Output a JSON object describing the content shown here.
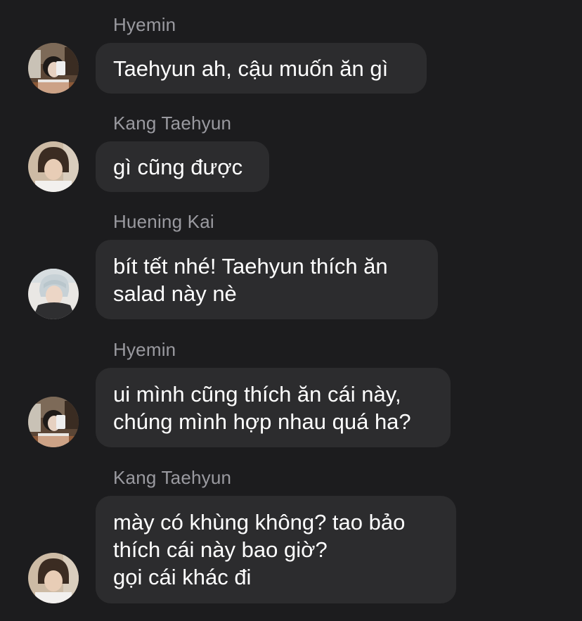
{
  "messages": [
    {
      "sender": "Hyemin",
      "avatar_icon": "profile-photo-hyemin",
      "lines": [
        "Taehyun ah, cậu muốn ăn gì"
      ]
    },
    {
      "sender": "Kang Taehyun",
      "avatar_icon": "profile-photo-taehyun",
      "lines": [
        "gì cũng được"
      ]
    },
    {
      "sender": "Huening Kai",
      "avatar_icon": "profile-photo-huening-kai",
      "lines": [
        "bít tết nhé! Taehyun thích ăn",
        "salad này nè"
      ]
    },
    {
      "sender": "Hyemin",
      "avatar_icon": "profile-photo-hyemin",
      "lines": [
        "ui mình cũng thích ăn cái này,",
        "chúng mình hợp nhau quá ha?"
      ]
    },
    {
      "sender": "Kang Taehyun",
      "avatar_icon": "profile-photo-taehyun",
      "lines": [
        "mày có khùng không? tao bảo",
        "thích cái này bao giờ?",
        "gọi cái khác đi"
      ]
    }
  ],
  "colors": {
    "background": "#1c1c1e",
    "bubble": "#2c2c2e",
    "sender_name": "#9a9aa0",
    "message_text": "#ffffff"
  }
}
